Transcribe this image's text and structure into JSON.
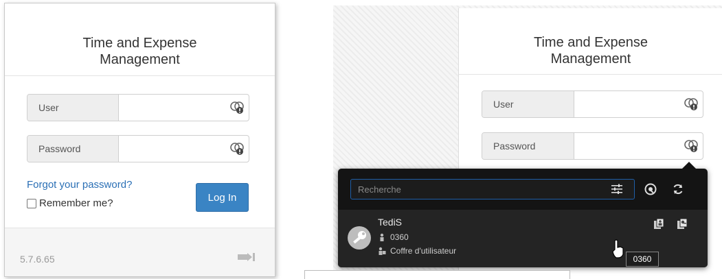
{
  "left": {
    "title_line1": "Time and Expense",
    "title_line2": "Management",
    "user_label": "User",
    "password_label": "Password",
    "forgot_link": "Forgot your password?",
    "remember_label": "Remember me?",
    "login_button": "Log In",
    "version": "5.7.6.65"
  },
  "right": {
    "title_line1": "Time and Expense",
    "title_line2": "Management",
    "user_label": "User",
    "password_label": "Password"
  },
  "popup": {
    "search_placeholder": "Recherche",
    "entry": {
      "name": "TediS",
      "login": "0360",
      "vault": "Coffre d'utilisateur"
    },
    "tooltip": "0360"
  },
  "colors": {
    "accent": "#3a84c4",
    "link": "#2a6fb5",
    "popup_bg": "#141414",
    "search_border": "#1f5fa8"
  },
  "icons": [
    "password-manager-icon",
    "filter-icon",
    "lock-icon",
    "refresh-icon",
    "copy-user-icon",
    "copy-password-icon",
    "key-icon",
    "person-icon",
    "vault-icon",
    "sign-in-icon",
    "cursor-icon"
  ]
}
